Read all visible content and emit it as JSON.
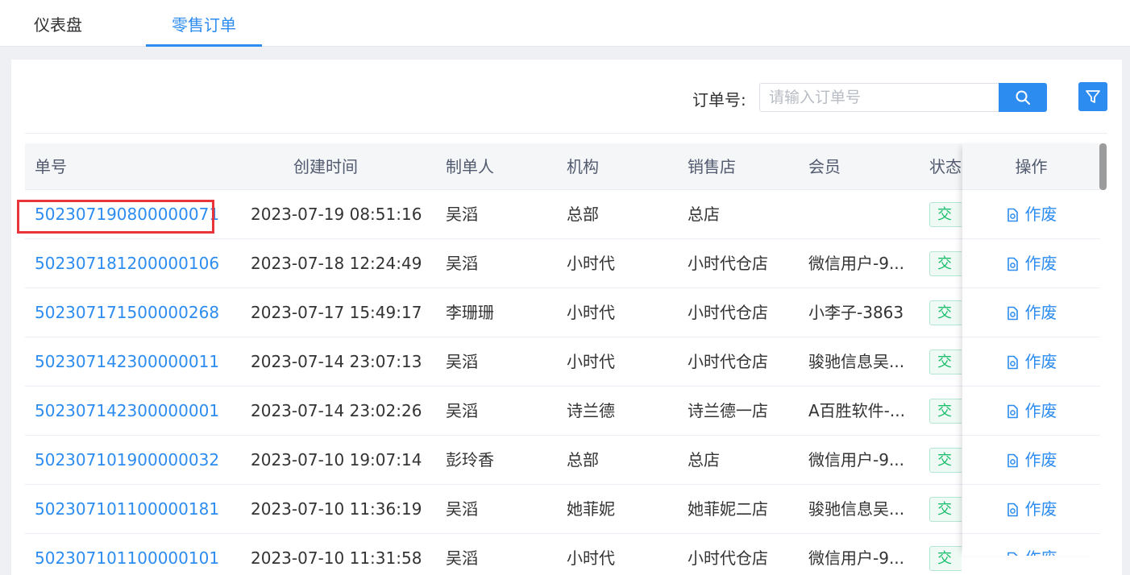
{
  "tabs": [
    {
      "label": "仪表盘",
      "active": false
    },
    {
      "label": "零售订单",
      "active": true
    }
  ],
  "search": {
    "label": "订单号:",
    "placeholder": "请输入订单号",
    "value": ""
  },
  "colors": {
    "accent": "#2d8cf0",
    "highlight_box": "#e8353b",
    "status_tag": "#19be6b"
  },
  "table": {
    "headers": {
      "order_no": "单号",
      "created": "创建时间",
      "maker": "制单人",
      "org": "机构",
      "store": "销售店",
      "member": "会员",
      "status": "状态",
      "action": "操作"
    },
    "rows": [
      {
        "order_no": "502307190800000071",
        "created": "2023-07-19 08:51:16",
        "maker": "吴滔",
        "org": "总部",
        "store": "总店",
        "member": "",
        "status": "交",
        "action": "作废"
      },
      {
        "order_no": "502307181200000106",
        "created": "2023-07-18 12:24:49",
        "maker": "吴滔",
        "org": "小时代",
        "store": "小时代仓店",
        "member": "微信用户-9...",
        "status": "交",
        "action": "作废"
      },
      {
        "order_no": "502307171500000268",
        "created": "2023-07-17 15:49:17",
        "maker": "李珊珊",
        "org": "小时代",
        "store": "小时代仓店",
        "member": "小李子-3863",
        "status": "交",
        "action": "作废"
      },
      {
        "order_no": "502307142300000011",
        "created": "2023-07-14 23:07:13",
        "maker": "吴滔",
        "org": "小时代",
        "store": "小时代仓店",
        "member": "骏驰信息吴...",
        "status": "交",
        "action": "作废"
      },
      {
        "order_no": "502307142300000001",
        "created": "2023-07-14 23:02:26",
        "maker": "吴滔",
        "org": "诗兰德",
        "store": "诗兰德一店",
        "member": "A百胜软件-...",
        "status": "交",
        "action": "作废"
      },
      {
        "order_no": "502307101900000032",
        "created": "2023-07-10 19:07:14",
        "maker": "彭玲香",
        "org": "总部",
        "store": "总店",
        "member": "微信用户-9...",
        "status": "交",
        "action": "作废"
      },
      {
        "order_no": "502307101100000181",
        "created": "2023-07-10 11:36:19",
        "maker": "吴滔",
        "org": "她菲妮",
        "store": "她菲妮二店",
        "member": "骏驰信息吴...",
        "status": "交",
        "action": "作废"
      },
      {
        "order_no": "502307101100000101",
        "created": "2023-07-10 11:31:58",
        "maker": "吴滔",
        "org": "小时代",
        "store": "小时代仓店",
        "member": "微信用户-9...",
        "status": "交",
        "action": "作废"
      }
    ]
  }
}
